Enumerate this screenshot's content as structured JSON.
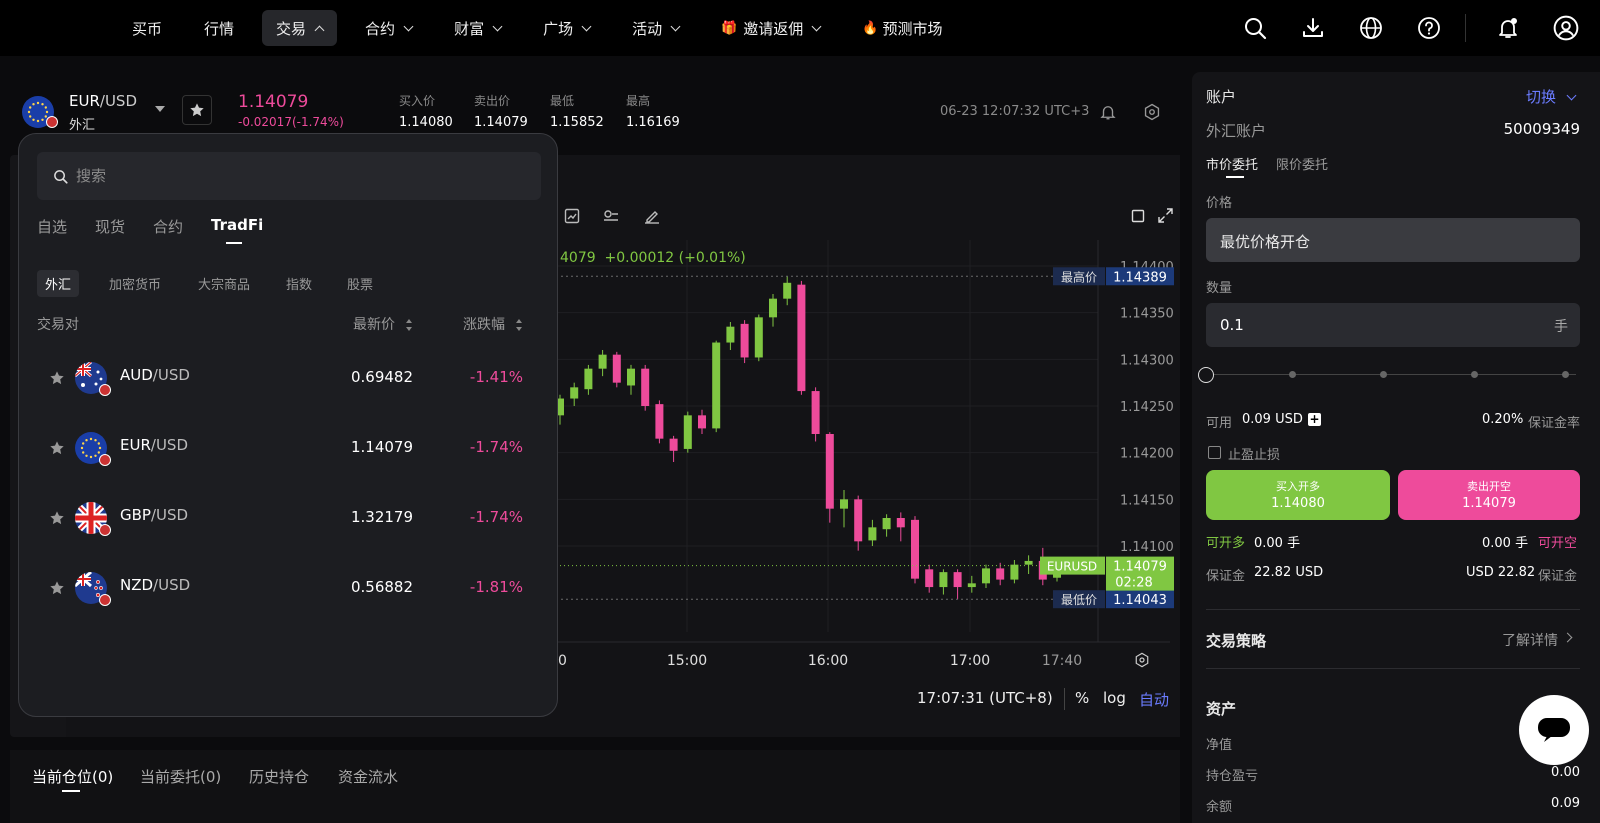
{
  "nav": {
    "items": [
      "买币",
      "行情",
      "交易",
      "合约",
      "财富",
      "广场",
      "活动",
      "邀请返佣",
      "预测市场"
    ],
    "active": "交易",
    "icons": [
      "search-icon",
      "download-icon",
      "globe-icon",
      "help-icon",
      "bell-icon",
      "user-icon"
    ]
  },
  "instrument": {
    "symbol_base": "EUR",
    "symbol_quote": "/USD",
    "category": "外汇",
    "price": "1.14079",
    "change": "-0.02017(-1.74%)",
    "stats": [
      {
        "label": "买入价",
        "value": "1.14080"
      },
      {
        "label": "卖出价",
        "value": "1.14079"
      },
      {
        "label": "最低",
        "value": "1.15852"
      },
      {
        "label": "最高",
        "value": "1.16169"
      }
    ],
    "time": "06-23 12:07:32 UTC+3"
  },
  "chart": {
    "legend_price": "4079",
    "legend_change": "+0.00012 (+0.01%)",
    "high_label": "最高价",
    "high_value": "1.14389",
    "low_label": "最低价",
    "low_value": "1.14043",
    "cur_label": "EURUSD",
    "cur_value": "1.14079",
    "cur_timer": "02:28",
    "y_ticks": [
      "1.14400",
      "1.14350",
      "1.14300",
      "1.14250",
      "1.14200",
      "1.14150",
      "1.14100"
    ],
    "x_ticks": [
      "0",
      "15:00",
      "16:00",
      "17:00",
      "17:40"
    ],
    "clock": "17:07:31 (UTC+8)",
    "opt_pct": "%",
    "opt_log": "log",
    "opt_auto": "自动"
  },
  "chart_data": {
    "type": "candlestick",
    "y_ticks": [
      1.141,
      1.1415,
      1.142,
      1.1425,
      1.143,
      1.1435,
      1.144
    ],
    "x_ticks": [
      "15:00",
      "16:00",
      "17:00",
      "17:40"
    ],
    "ylim": [
      1.1408,
      1.1441
    ],
    "high": 1.14389,
    "low": 1.14043,
    "last": 1.14079,
    "candles": [
      [
        1.1424,
        1.14258,
        1.1423,
        1.14262
      ],
      [
        1.14258,
        1.1427,
        1.1425,
        1.14275
      ],
      [
        1.14268,
        1.1429,
        1.14262,
        1.14294
      ],
      [
        1.1429,
        1.14305,
        1.14282,
        1.1431
      ],
      [
        1.14305,
        1.14275,
        1.1427,
        1.14308
      ],
      [
        1.14272,
        1.1429,
        1.14262,
        1.14294
      ],
      [
        1.1429,
        1.1425,
        1.14245,
        1.14294
      ],
      [
        1.14252,
        1.14215,
        1.1421,
        1.14256
      ],
      [
        1.14215,
        1.14202,
        1.1419,
        1.14218
      ],
      [
        1.14204,
        1.1424,
        1.142,
        1.14244
      ],
      [
        1.1424,
        1.14226,
        1.1422,
        1.14246
      ],
      [
        1.14226,
        1.14318,
        1.14222,
        1.1432
      ],
      [
        1.14318,
        1.14335,
        1.1431,
        1.1434
      ],
      [
        1.14338,
        1.14302,
        1.14296,
        1.14342
      ],
      [
        1.14302,
        1.14345,
        1.14298,
        1.14348
      ],
      [
        1.14345,
        1.14365,
        1.14335,
        1.1437
      ],
      [
        1.14365,
        1.14382,
        1.14358,
        1.14389
      ],
      [
        1.1438,
        1.14266,
        1.14262,
        1.14384
      ],
      [
        1.14266,
        1.1422,
        1.14212,
        1.1427
      ],
      [
        1.1422,
        1.1414,
        1.14125,
        1.14222
      ],
      [
        1.1414,
        1.1415,
        1.1412,
        1.1416
      ],
      [
        1.1415,
        1.14105,
        1.14095,
        1.14154
      ],
      [
        1.14106,
        1.1412,
        1.141,
        1.14128
      ],
      [
        1.14118,
        1.1413,
        1.1411,
        1.14134
      ],
      [
        1.1413,
        1.1412,
        1.14105,
        1.14136
      ],
      [
        1.14128,
        1.14065,
        1.1406,
        1.14132
      ],
      [
        1.14075,
        1.14056,
        1.1405,
        1.1408
      ],
      [
        1.14056,
        1.14072,
        1.14048,
        1.14075
      ],
      [
        1.14072,
        1.14056,
        1.14043,
        1.14075
      ],
      [
        1.14056,
        1.1406,
        1.1405,
        1.14068
      ],
      [
        1.1406,
        1.14076,
        1.14055,
        1.1408
      ],
      [
        1.14076,
        1.14064,
        1.14058,
        1.14082
      ],
      [
        1.14064,
        1.1408,
        1.1406,
        1.14085
      ],
      [
        1.1408,
        1.14084,
        1.1407,
        1.1409
      ],
      [
        1.14084,
        1.14064,
        1.14058,
        1.14098
      ],
      [
        1.14066,
        1.14079,
        1.14062,
        1.14083
      ]
    ]
  },
  "dropdown": {
    "search_placeholder": "搜索",
    "tabs": [
      "自选",
      "现货",
      "合约",
      "TradFi"
    ],
    "subtabs": [
      "外汇",
      "加密货币",
      "大宗商品",
      "指数",
      "股票"
    ],
    "col_pair": "交易对",
    "col_price": "最新价",
    "col_change": "涨跌幅",
    "rows": [
      {
        "base": "AUD",
        "quote": "/USD",
        "price": "0.69482",
        "change": "-1.41%"
      },
      {
        "base": "EUR",
        "quote": "/USD",
        "price": "1.14079",
        "change": "-1.74%"
      },
      {
        "base": "GBP",
        "quote": "/USD",
        "price": "1.32179",
        "change": "-1.74%"
      },
      {
        "base": "NZD",
        "quote": "/USD",
        "price": "0.56882",
        "change": "-1.81%"
      }
    ]
  },
  "bottom": {
    "tabs": [
      "当前仓位(0)",
      "当前委托(0)",
      "历史持仓",
      "资金流水"
    ]
  },
  "account": {
    "title": "账户",
    "switch": "切换",
    "acct_label": "外汇账户",
    "acct_no": "50009349",
    "order_tabs": [
      "市价委托",
      "限价委托"
    ],
    "price_label": "价格",
    "price_value": "最优价格开仓",
    "qty_label": "数量",
    "qty_value": "0.1",
    "qty_unit": "手",
    "avail_label": "可用",
    "avail_value": "0.09 USD",
    "margin_rate": "0.20%",
    "margin_rate_label": "保证金率",
    "tpsl": "止盈止损",
    "buy_label": "买入开多",
    "buy_price": "1.14080",
    "sell_label": "卖出开空",
    "sell_price": "1.14079",
    "can_long": "可开多",
    "can_long_val": "0.00 手",
    "can_short_val": "0.00 手",
    "can_short": "可开空",
    "margin_label": "保证金",
    "margin_val": "22.82 USD",
    "margin_val2": "USD 22.82",
    "margin_label2": "保证金",
    "strategy": "交易策略",
    "learn_more": "了解详情",
    "assets": "资产",
    "net": "净值",
    "pnl": "持仓盈亏",
    "pnl_val": "0.00",
    "balance": "余额",
    "balance_val": "0.09"
  },
  "colors": {
    "up": "#80c742",
    "down": "#ee4b9b",
    "accent": "#6b7cff"
  }
}
